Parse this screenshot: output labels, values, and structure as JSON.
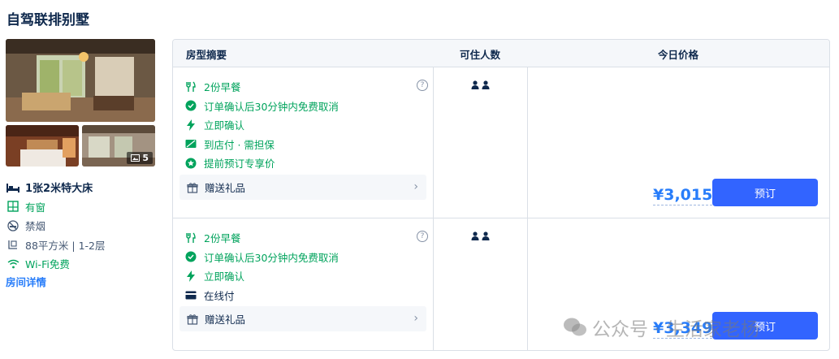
{
  "room": {
    "name": "自驾联排别墅",
    "photo_count": "5",
    "facts": {
      "bed": "1张2米特大床",
      "window": "有窗",
      "smoking": "禁烟",
      "area": "88平方米 | 1-2层",
      "wifi": "Wi-Fi免费"
    },
    "details_link": "房间详情"
  },
  "table": {
    "headers": {
      "summary": "房型摘要",
      "occupancy": "可住人数",
      "price": "今日价格"
    },
    "rows": [
      {
        "perks": {
          "breakfast": "2份早餐",
          "cancel": "订单确认后30分钟内免费取消",
          "instant": "立即确认",
          "payment": "到店付 · 需担保",
          "promo": "提前预订专享价"
        },
        "gift": "赠送礼品",
        "price": "¥3,015",
        "book": "预订"
      },
      {
        "perks": {
          "breakfast": "2份早餐",
          "cancel": "订单确认后30分钟内免费取消",
          "instant": "立即确认",
          "payment": "在线付"
        },
        "gift": "赠送礼品",
        "price": "¥3,349",
        "book": "预订"
      }
    ]
  },
  "watermark": "公众号 · 生活家老杨",
  "colors": {
    "accent": "#287dfa",
    "button": "#3264ff",
    "green": "#00a35c",
    "text": "#0f294d",
    "border": "#dadfe6"
  }
}
